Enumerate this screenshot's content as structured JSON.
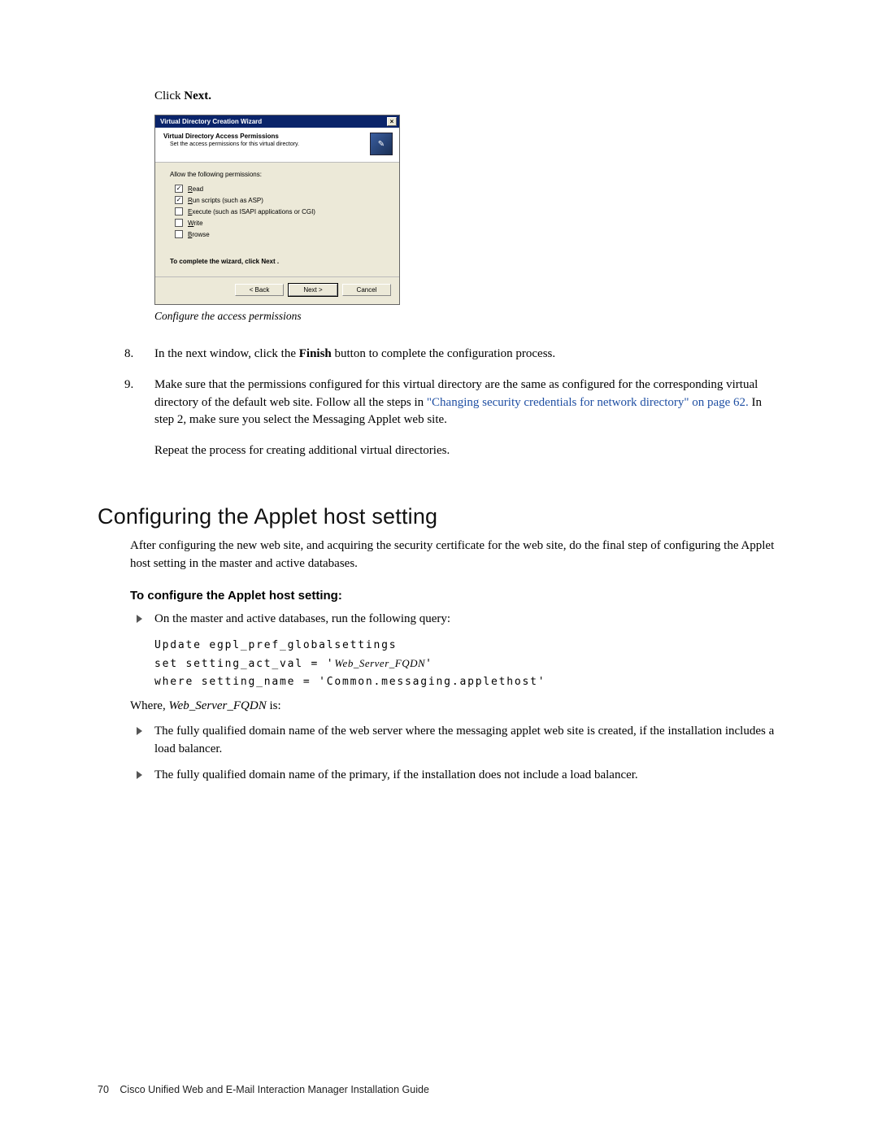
{
  "intro": {
    "click_prefix": "Click ",
    "click_bold": "Next."
  },
  "dialog": {
    "title": "Virtual Directory Creation Wizard",
    "close_glyph": "×",
    "header_title": "Virtual Directory Access Permissions",
    "header_sub": "Set the access permissions for this virtual directory.",
    "icon_glyph": "✎",
    "permissions_label": "Allow the following permissions:",
    "checkboxes": [
      {
        "checked": true,
        "u": "R",
        "rest": "ead"
      },
      {
        "checked": true,
        "u": "R",
        "rest": "un scripts (such as ASP)"
      },
      {
        "checked": false,
        "u": "E",
        "rest": "xecute (such as ISAPI applications or CGI)"
      },
      {
        "checked": false,
        "u": "W",
        "rest": "rite"
      },
      {
        "checked": false,
        "u": "B",
        "rest": "rowse"
      }
    ],
    "complete_note": "To complete the wizard, click Next .",
    "buttons": {
      "back": "< Back",
      "next": "Next >",
      "cancel": "Cancel"
    }
  },
  "caption": "Configure the access permissions",
  "steps": {
    "start": 8,
    "items": [
      {
        "pre": "In the next window, click the ",
        "bold": "Finish",
        "post": " button to complete the configuration process."
      },
      {
        "pre": "Make sure that the permissions configured for this virtual directory are the same as configured for the corresponding virtual directory of the default web site. Follow all the steps in ",
        "link": "\"Changing security credentials for network directory\" on page 62.",
        "post": " In step 2, make sure you select the Messaging Applet web site."
      }
    ]
  },
  "repeat_note": "Repeat the process for creating additional virtual directories.",
  "section_heading": "Configuring the Applet host setting",
  "section_intro": "After configuring the new web site, and acquiring the security certificate for the web site, do the final step of configuring the Applet host setting in the master and active databases.",
  "task_heading": "To configure the Applet host setting:",
  "task_bullet": "On the master and active databases, run the following query:",
  "code": {
    "line1": "Update egpl_pref_globalsettings",
    "line2a": "set setting_act_val = '",
    "line2_ital": "Web_Server_FQDN",
    "line2b": "'",
    "line3": "where setting_name = 'Common.messaging.applethost'"
  },
  "where": {
    "pre": "Where, ",
    "ital": "Web_Server_FQDN",
    "post": " is:"
  },
  "fqdn_bullets": [
    "The fully qualified domain name of the web server where the messaging applet web site is created, if the installation includes a load balancer.",
    "The fully qualified domain name of the primary, if the installation does not include a load balancer."
  ],
  "footer": {
    "page_no": "70",
    "title": "Cisco Unified Web and E-Mail Interaction Manager Installation Guide"
  }
}
